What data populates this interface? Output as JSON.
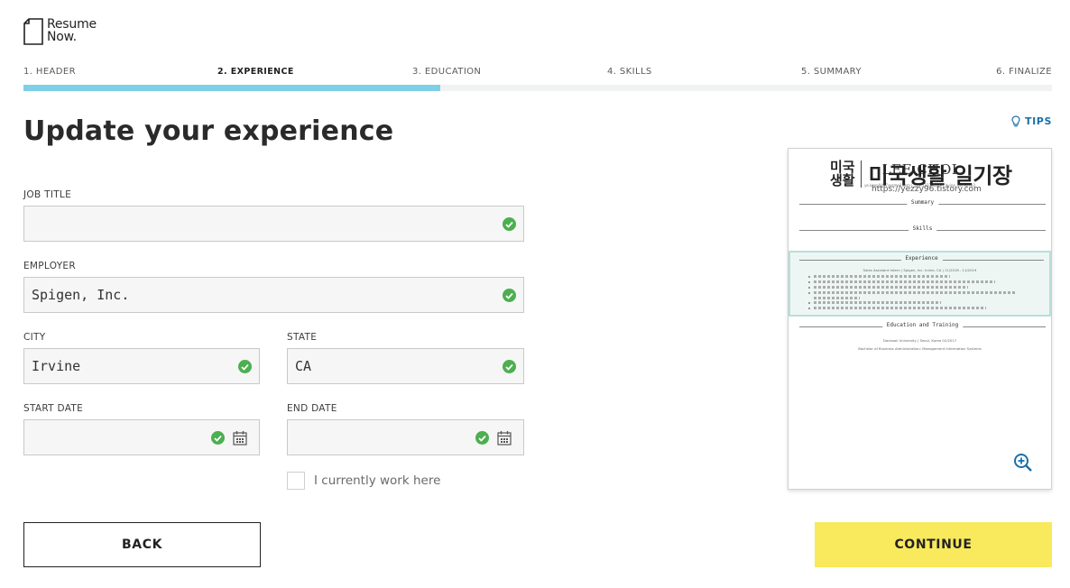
{
  "logo": {
    "line1": "Resume",
    "line2": "Now."
  },
  "steps": [
    {
      "label": "1. HEADER"
    },
    {
      "label": "2. EXPERIENCE"
    },
    {
      "label": "3. EDUCATION"
    },
    {
      "label": "4. SKILLS"
    },
    {
      "label": "5. SUMMARY"
    },
    {
      "label": "6. FINALIZE"
    }
  ],
  "progress": {
    "fraction": 0.405,
    "color": "#7ecfe8"
  },
  "page": {
    "title": "Update your experience"
  },
  "tips": {
    "label": "TIPS",
    "icon": "lightbulb-icon"
  },
  "form": {
    "job_title": {
      "label": "JOB TITLE",
      "value": ""
    },
    "employer": {
      "label": "EMPLOYER",
      "value": "Spigen, Inc."
    },
    "city": {
      "label": "CITY",
      "value": "Irvine"
    },
    "state": {
      "label": "STATE",
      "value": "CA"
    },
    "start_date": {
      "label": "START DATE",
      "value": ""
    },
    "end_date": {
      "label": "END DATE",
      "value": ""
    },
    "currently_work": {
      "label": "I currently work here",
      "checked": false
    }
  },
  "preview": {
    "watermark": {
      "box": "미국\n생활",
      "title": "미국생활 일기장",
      "url": "https://yezzy96.tistory.com"
    },
    "name": "LEE          CHOI",
    "contact": "ye.keep0407@gmail.com  |  123-1233-4352  |  Irvine, CA 92793",
    "sections": {
      "summary": "Summary",
      "skills": "Skills",
      "experience": "Experience",
      "education": "Education and Training"
    },
    "job_line": "Sales Assistant Intern  |  Spigen, Inc. Irvine, CA  |  11/2018 - 11/2019",
    "edu_line1": "Dankook University  |  Seoul, Korea 02/2017",
    "edu_line2": "Bachelor of Business Administration: Management Information Systems"
  },
  "buttons": {
    "back": "BACK",
    "continue": "CONTINUE"
  },
  "colors": {
    "accent": "#1b6fa8",
    "continue_bg": "#f9e95c",
    "check": "#4caf50"
  }
}
